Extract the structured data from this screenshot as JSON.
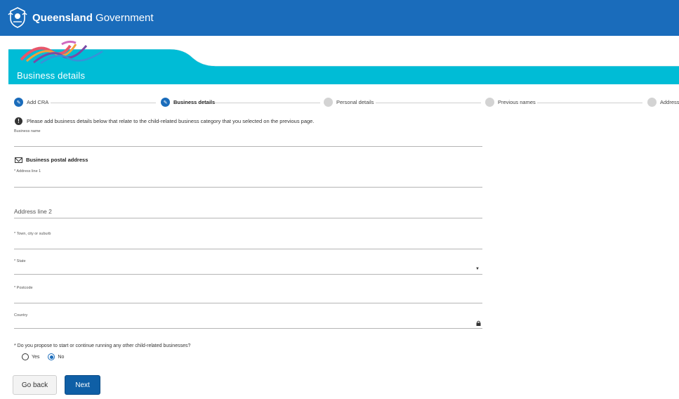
{
  "header": {
    "brand_bold": "Queensland",
    "brand_rest": " Government"
  },
  "hero": {
    "title": "Business details"
  },
  "stepper": {
    "steps": [
      {
        "label": "Add CRA",
        "state": "done"
      },
      {
        "label": "Business details",
        "state": "current"
      },
      {
        "label": "Personal details",
        "state": "todo"
      },
      {
        "label": "Previous names",
        "state": "todo"
      },
      {
        "label": "Address",
        "state": "todo"
      }
    ]
  },
  "info": {
    "text": "Please add business details below that relate to the child-related business category that you selected on the previous page."
  },
  "form": {
    "business_name_label": "Business name",
    "postal_section_title": "Business postal address",
    "address1_label": "* Address line 1",
    "address2_label": "Address line 2",
    "town_label": "* Town, city or suburb",
    "state_label": "* State",
    "postcode_label": "* Postcode",
    "country_label": "Country",
    "question": "* Do you propose to start or continue running any other child-related businesses?",
    "yes_label": "Yes",
    "no_label": "No",
    "selected": "No"
  },
  "buttons": {
    "back": "Go back",
    "next": "Next"
  },
  "colors": {
    "header": "#1a6cbb",
    "hero": "#00bcd6",
    "primary_button": "#0f5fa6"
  }
}
